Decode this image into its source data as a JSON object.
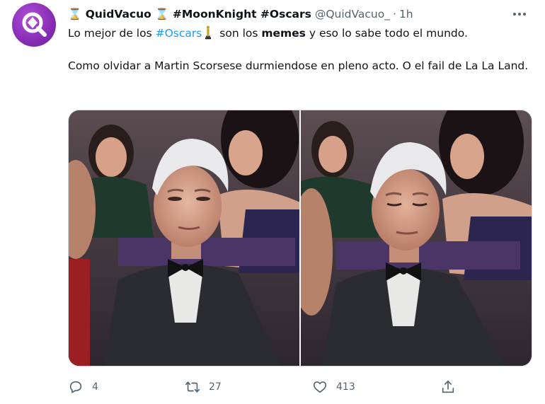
{
  "author": {
    "display_name": "⌛ QuidVacuo ⌛ #MoonKnight #Oscars",
    "handle": "@QuidVacuo_",
    "separator": "·",
    "time": "1h",
    "avatar_icon": "magnifier-logo-icon",
    "avatar_color": "#8a2fb8"
  },
  "tweet": {
    "line1_before": "Lo mejor de los ",
    "line1_hashtag": "#Oscars",
    "line1_emoji_icon": "oscar-statuette-icon",
    "line1_middle": " son los ",
    "line1_bold": "memes",
    "line1_after": " y eso lo sabe todo el mundo.",
    "line2": "Como olvidar a Martin Scorsese durmiendose en pleno acto. O el fail de La La Land."
  },
  "media": {
    "images": [
      {
        "icon": "photo-scorsese-eyes-half-open"
      },
      {
        "icon": "photo-scorsese-eyes-closed"
      }
    ]
  },
  "actions": {
    "reply": {
      "icon": "reply-icon",
      "count": "4"
    },
    "retweet": {
      "icon": "retweet-icon",
      "count": "27"
    },
    "like": {
      "icon": "heart-icon",
      "count": "413"
    },
    "share": {
      "icon": "share-icon"
    }
  },
  "colors": {
    "accent": "#1d9bf0",
    "secondary_text": "#536471",
    "primary_text": "#0f1419"
  }
}
